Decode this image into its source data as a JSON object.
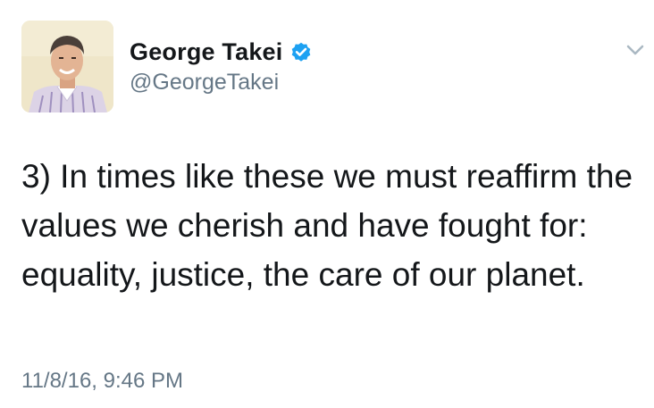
{
  "tweet": {
    "author": {
      "display_name": "George Takei",
      "handle": "@GeorgeTakei",
      "verified": true,
      "avatar_icon": "profile-photo"
    },
    "text": "3) In times like these we must reaffirm the values we cherish and have fought for: equality, justice, the care of our planet.",
    "timestamp": "11/8/16, 9:46 PM",
    "menu_icon": "chevron-down-icon"
  },
  "colors": {
    "text_primary": "#14171a",
    "text_secondary": "#657786",
    "verified_badge": "#1da1f2",
    "caret": "#aab8c2"
  }
}
